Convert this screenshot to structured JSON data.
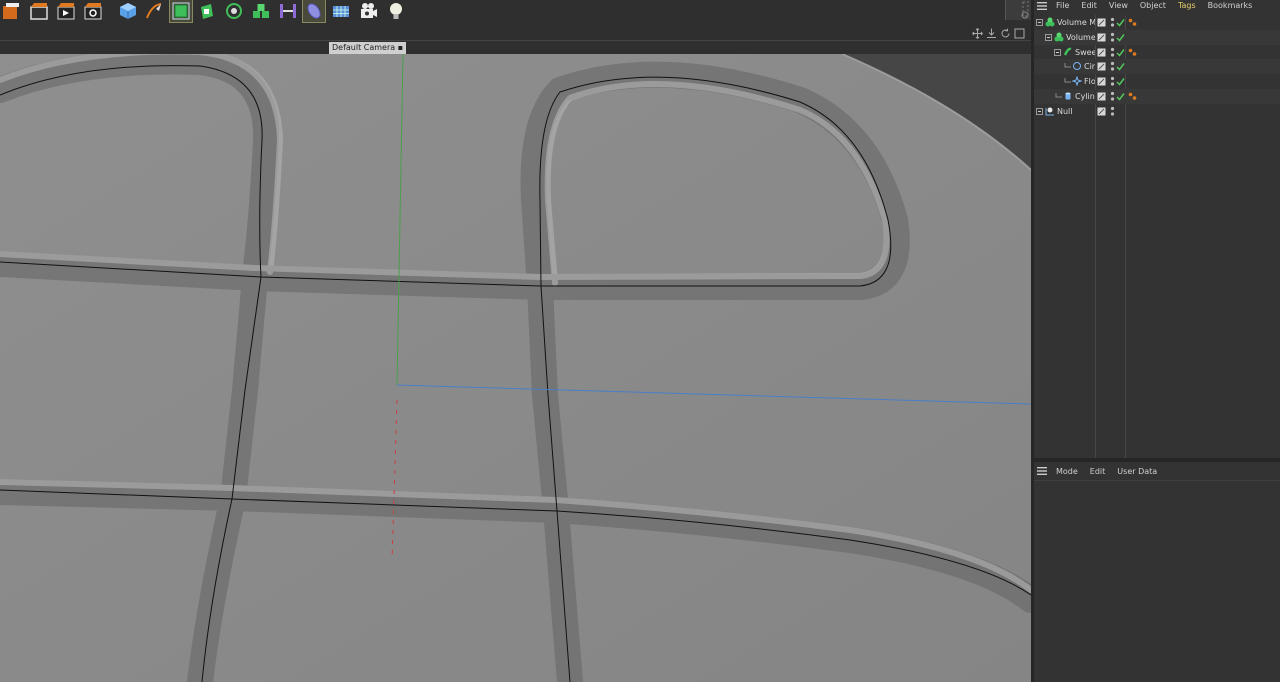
{
  "toolbar": {
    "buttons": [
      {
        "name": "render-region-icon",
        "active": false
      },
      {
        "name": "render-view-icon",
        "active": false
      },
      {
        "name": "render-to-picture-viewer-icon",
        "active": false
      },
      {
        "name": "render-settings-icon",
        "active": false
      },
      {
        "name": "cube-primitive-icon",
        "active": false
      },
      {
        "name": "pen-spline-icon",
        "active": false
      },
      {
        "name": "subdivision-surface-icon",
        "active": true
      },
      {
        "name": "extrude-generator-icon",
        "active": false
      },
      {
        "name": "cloner-icon",
        "active": false
      },
      {
        "name": "volume-builder-icon",
        "active": false
      },
      {
        "name": "bend-deformer-icon",
        "active": false
      },
      {
        "name": "floor-object-icon",
        "active": true
      },
      {
        "name": "grid-plane-icon",
        "active": false
      },
      {
        "name": "camera-icon",
        "active": false
      },
      {
        "name": "light-icon",
        "active": false
      }
    ]
  },
  "viewport": {
    "camera_label": "Default Camera"
  },
  "object_manager": {
    "menu": [
      "File",
      "Edit",
      "View",
      "Object",
      "Tags",
      "Bookmarks"
    ],
    "tree": [
      {
        "label": "Volume M",
        "icon": "volume-mesher-icon",
        "depth": 0,
        "expandable": true,
        "has_tag": true
      },
      {
        "label": "Volume",
        "icon": "volume-builder-icon",
        "depth": 1,
        "expandable": true,
        "has_tag": false
      },
      {
        "label": "Swee",
        "icon": "sweep-icon",
        "depth": 2,
        "expandable": true,
        "has_tag": true
      },
      {
        "label": "Cir",
        "icon": "circle-spline-icon",
        "depth": 3,
        "expandable": false,
        "has_tag": false
      },
      {
        "label": "Flo",
        "icon": "flower-spline-icon",
        "depth": 3,
        "expandable": false,
        "has_tag": false
      },
      {
        "label": "Cylin",
        "icon": "cylinder-icon",
        "depth": 2,
        "expandable": false,
        "has_tag": true
      },
      {
        "label": "Null",
        "icon": "null-object-icon",
        "depth": 0,
        "expandable": true,
        "has_tag": false
      }
    ]
  },
  "attribute_manager": {
    "menu": [
      "Mode",
      "Edit",
      "User Data"
    ]
  },
  "colors": {
    "viewport_bg": "#8e8e8e",
    "panel_bg": "#333333",
    "tags_accent": "#e6cc6a",
    "check_green": "#52c65a",
    "tag_orange": "#e07a20"
  }
}
